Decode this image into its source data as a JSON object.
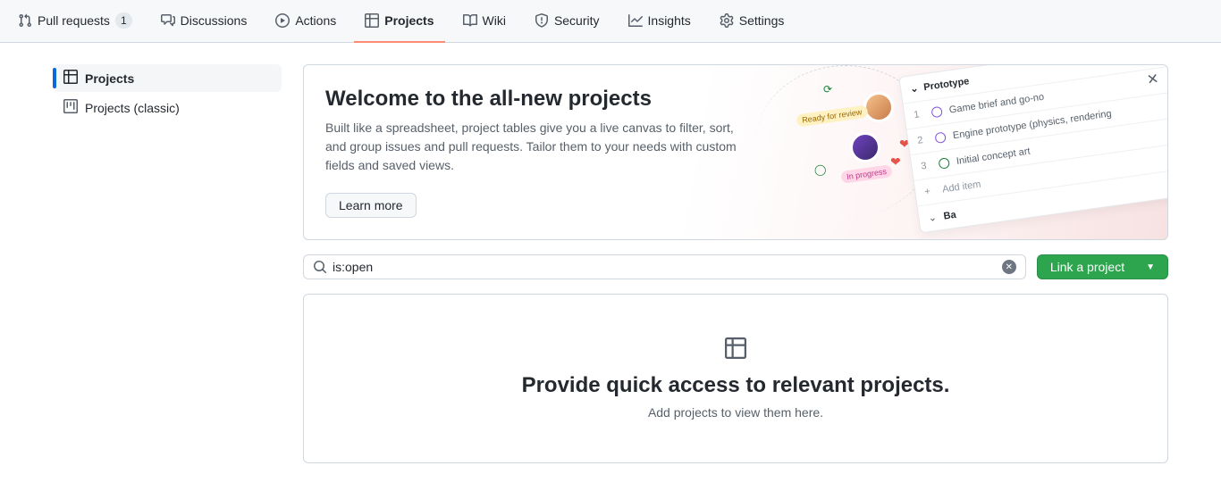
{
  "topnav": {
    "pull_requests": {
      "label": "Pull requests",
      "count": "1"
    },
    "discussions": {
      "label": "Discussions"
    },
    "actions": {
      "label": "Actions"
    },
    "projects": {
      "label": "Projects"
    },
    "wiki": {
      "label": "Wiki"
    },
    "security": {
      "label": "Security"
    },
    "insights": {
      "label": "Insights"
    },
    "settings": {
      "label": "Settings"
    }
  },
  "sidebar": {
    "projects": "Projects",
    "projects_classic": "Projects (classic)"
  },
  "welcome": {
    "title": "Welcome to the all-new projects",
    "body": "Built like a spreadsheet, project tables give you a live canvas to filter, sort, and group issues and pull requests. Tailor them to your needs with custom fields and saved views.",
    "learn_more": "Learn more"
  },
  "illustration": {
    "header": "Prototype",
    "rows": [
      {
        "num": "1",
        "text": "Game brief and go-no"
      },
      {
        "num": "2",
        "text": "Engine prototype (physics, rendering"
      },
      {
        "num": "3",
        "text": "Initial concept art"
      }
    ],
    "add_item": "Add item",
    "tag_ready": "Ready for review",
    "tag_progress": "In progress"
  },
  "search": {
    "value": "is:open"
  },
  "link_button": "Link a project",
  "empty": {
    "title": "Provide quick access to relevant projects.",
    "subtitle": "Add projects to view them here."
  }
}
